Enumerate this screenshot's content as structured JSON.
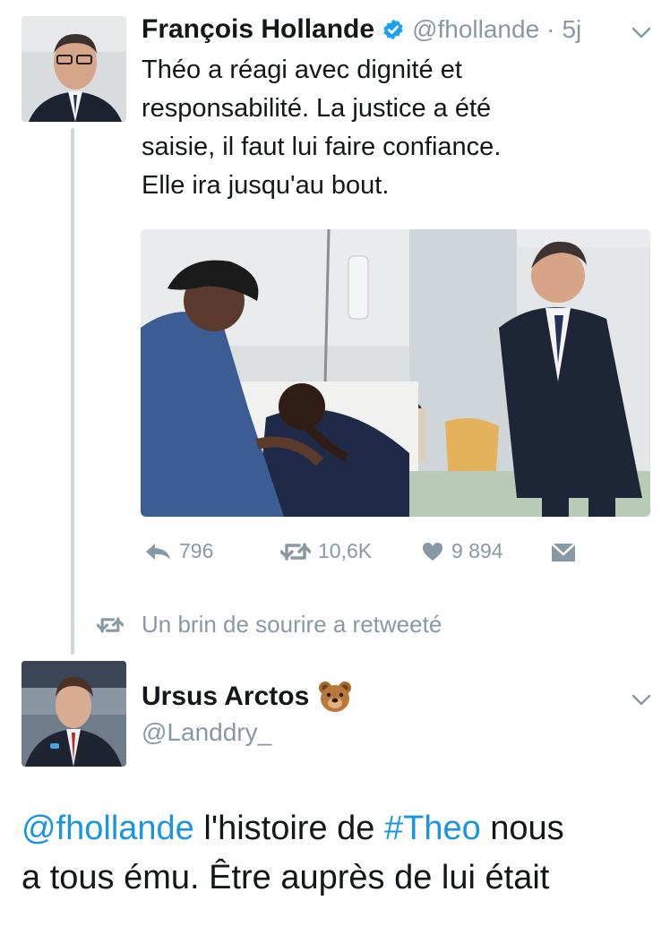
{
  "tweet1": {
    "author_name": "François Hollande",
    "handle": "@fhollande",
    "separator": "·",
    "time": "5j",
    "text_lines": [
      "Théo a réagi avec dignité et",
      "responsabilité. La justice a été",
      "saisie, il faut lui faire confiance.",
      "Elle ira jusqu'au bout."
    ],
    "reply_count": "796",
    "retweet_count": "10,6K",
    "like_count": "9 894"
  },
  "retweet_banner": {
    "text": "Un brin de sourire a retweeté"
  },
  "tweet2": {
    "author_name": "Ursus Arctos",
    "name_emoji": "🐻",
    "handle": "@Landdry_",
    "mention": "@fhollande",
    "text_part1": " l'histoire de ",
    "hashtag": "#Theo",
    "text_part2": " nous",
    "line2": "a tous ému. Être auprès de lui était"
  },
  "colors": {
    "link": "#1b95e0",
    "muted": "#8899a6",
    "verified": "#1da1f2",
    "thread_line": "#ccd6dd"
  },
  "icons": [
    "verified-icon",
    "chevron-down-icon",
    "reply-icon",
    "retweet-icon",
    "like-icon",
    "dm-icon"
  ]
}
